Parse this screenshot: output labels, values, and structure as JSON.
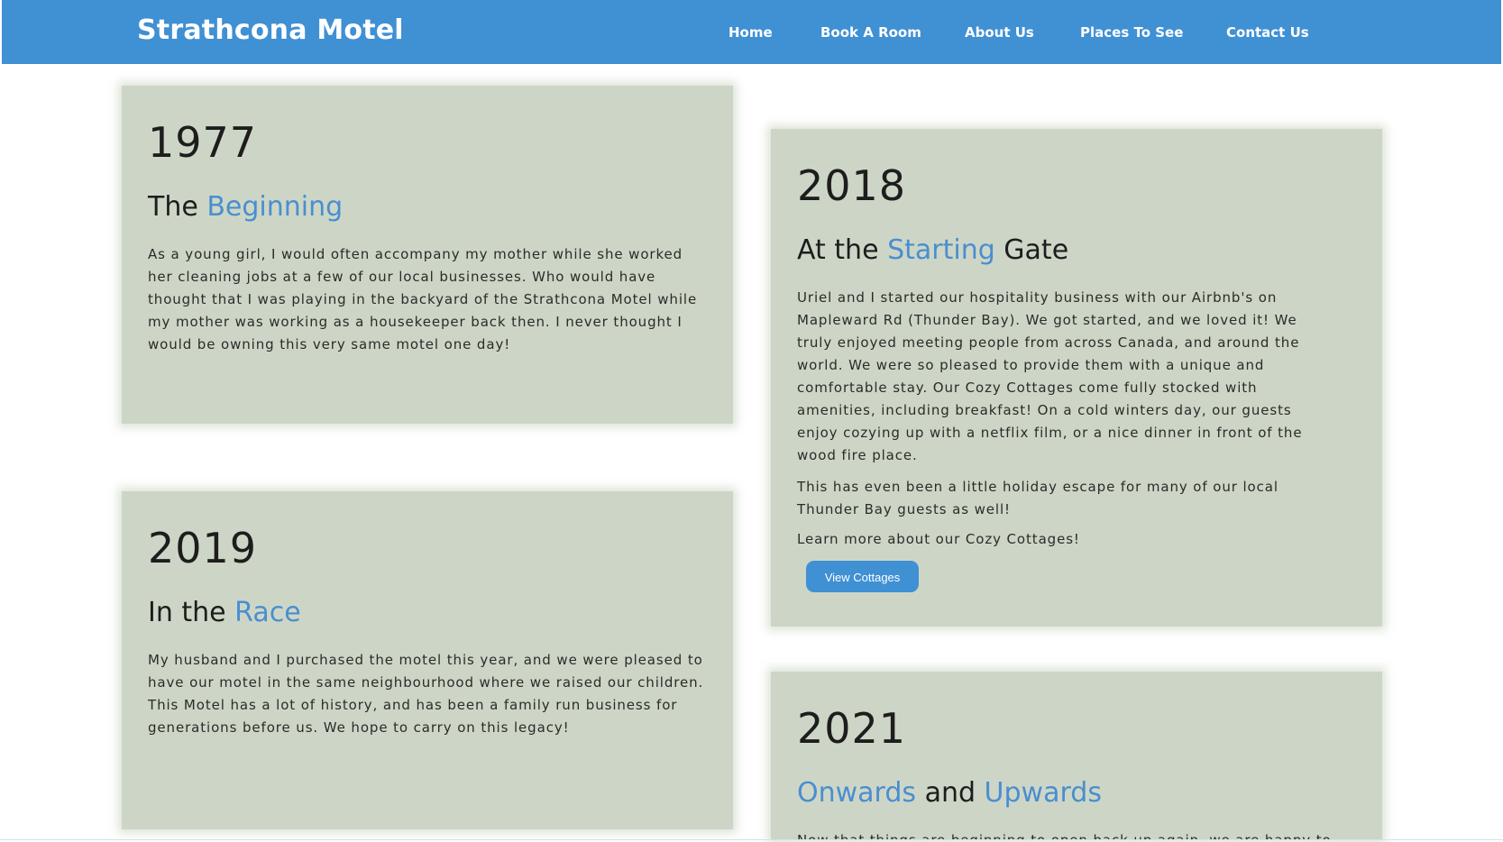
{
  "navbar": {
    "brand": "Strathcona Motel",
    "items": [
      "Home",
      "Book A Room",
      "About Us",
      "Places To See",
      "Contact Us"
    ],
    "background": "#4090d4"
  },
  "cards": {
    "c1977": {
      "year": "1977",
      "heading": [
        "The ",
        "Beginning"
      ],
      "paragraphs": [
        "As a young girl, I would often accompany my mother while she worked her cleaning jobs at a few of our local businesses. Who would have thought that I was playing in the backyard of the Strathcona Motel while my mother was working as a housekeeper back then. I never thought I would be owning this very same motel one day!"
      ]
    },
    "c2018": {
      "year": "2018",
      "heading": [
        "At the ",
        "Starting",
        " Gate"
      ],
      "paragraphs": [
        "Uriel and I started our hospitality business with our Airbnb's on Mapleward Rd (Thunder Bay). We got started, and we loved it! We truly enjoyed meeting people from across Canada, and around the world. We were so pleased to provide them with a unique and comfortable stay. Our Cozy Cottages come fully stocked with amenities, including breakfast! On a cold winters day, our guests enjoy cozying up with a netflix film, or a nice dinner in front of the wood fire place.",
        "This has even been a little holiday escape for many of our local Thunder Bay guests as well!",
        "Learn more about our Cozy Cottages!"
      ],
      "button": "View Cottages"
    },
    "c2019": {
      "year": "2019",
      "heading": [
        "In the ",
        "Race"
      ],
      "paragraphs": [
        "My husband and I purchased the motel this year, and we were pleased to have our motel in the same neighbourhood where we raised our children. This Motel has a lot of history, and has been a family run business for generations before us. We hope to carry on this legacy!"
      ]
    },
    "c2021": {
      "year": "2021",
      "heading": [
        "Onwards",
        " and ",
        "Upwards"
      ],
      "paragraphs": [
        "Now that things are beginning to open back up again, we are happy to"
      ]
    }
  },
  "colors": {
    "accent": "#4a8ed0",
    "card_background": "#cdd6c6",
    "text": "#1d1d1d"
  }
}
